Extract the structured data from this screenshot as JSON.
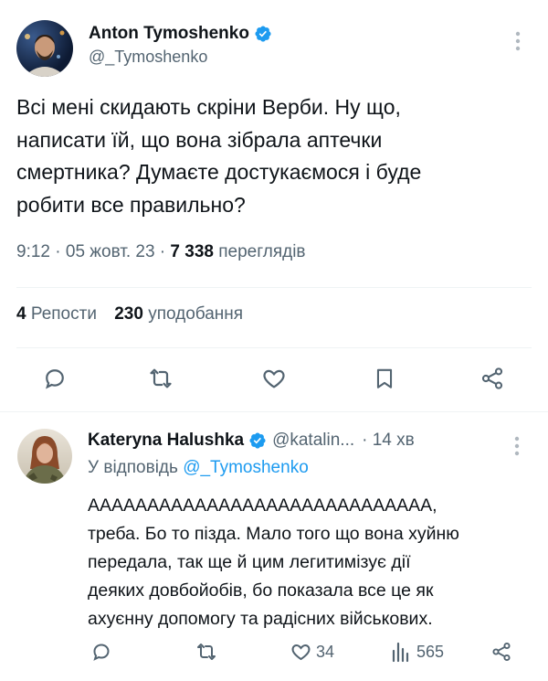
{
  "main_tweet": {
    "author_name": "Anton Tymoshenko",
    "handle": "@_Tymoshenko",
    "text_lines": [
      "Всі мені скидають скріни Верби. Ну що,",
      "написати їй, що вона зібрала аптечки",
      "смертника? Думаєте достукаємося і буде",
      "робити все правильно?"
    ],
    "meta": {
      "time": "9:12",
      "sep": " · ",
      "date": "05 жовт. 23",
      "views_count": "7 338",
      "views_label": "переглядів"
    },
    "stats": {
      "reposts_count": "4",
      "reposts_label": "Репости",
      "likes_count": "230",
      "likes_label": "уподобання"
    },
    "actions": [
      "reply-icon",
      "repost-icon",
      "like-icon",
      "bookmark-icon",
      "share-icon"
    ]
  },
  "reply": {
    "author_name": "Kateryna Halushka",
    "handle": "@katalin...",
    "time": "· 14 хв",
    "replying_to_label": "У відповідь",
    "replying_to_handle": "@_Tymoshenko",
    "text_lines": [
      "ААААААААААААААААААААААААААААА,",
      "треба. Бо то пізда. Мало того що вона хуйню",
      "передала, так ще й цим легитимізує дії",
      "деяких довбойобів, бо показала все це як",
      "ахуєнну допомогу та радісних військових."
    ],
    "likes": "34",
    "views": "565"
  },
  "colors": {
    "accent": "#1d9bf0",
    "text": "#0f1419",
    "muted": "#536471",
    "divider": "#eff3f4"
  }
}
